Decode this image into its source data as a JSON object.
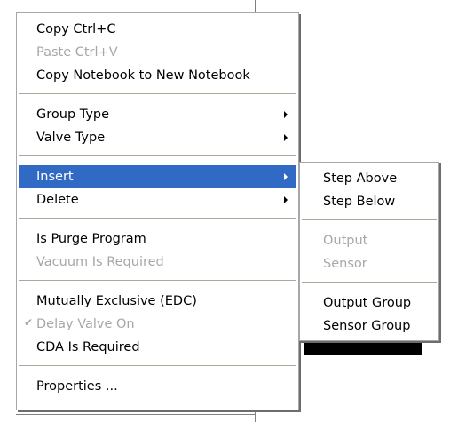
{
  "context_menu": {
    "copy": "Copy  Ctrl+C",
    "paste": "Paste Ctrl+V",
    "copy_notebook": "Copy Notebook to New Notebook",
    "group_type": "Group Type",
    "valve_type": "Valve Type",
    "insert": "Insert",
    "delete": "Delete",
    "is_purge_program": "Is Purge Program",
    "vacuum_is_required": "Vacuum Is Required",
    "mutually_exclusive": "Mutually Exclusive (EDC)",
    "delay_valve_on": "Delay Valve On",
    "delay_valve_on_checked": true,
    "cda_is_required": "CDA Is Required",
    "properties": "Properties ..."
  },
  "insert_submenu": {
    "step_above": "Step Above",
    "step_below": "Step Below",
    "output": "Output",
    "sensor": "Sensor",
    "output_group": "Output Group",
    "sensor_group": "Sensor Group"
  },
  "colors": {
    "highlight": "#316ac5",
    "disabled_text": "#a7a6aa",
    "menu_background": "#ffffff"
  },
  "icons": {
    "checkmark": "checkmark-icon",
    "submenu_arrow": "submenu-arrow-icon"
  }
}
